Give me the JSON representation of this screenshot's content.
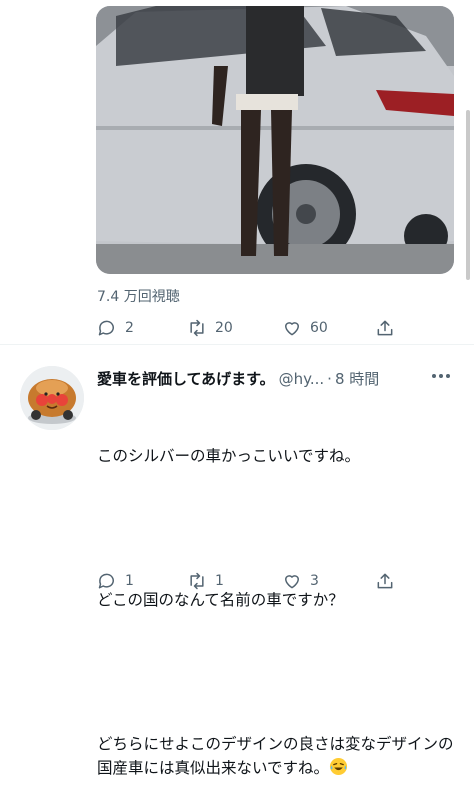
{
  "tweet": {
    "views": "7.4 万回視聴",
    "actions": {
      "reply_count": "2",
      "retweet_count": "20",
      "like_count": "60"
    }
  },
  "reply": {
    "display_name": "愛車を評価してあげます。",
    "handle": "@hy...",
    "separator": "·",
    "time": "8 時間",
    "paragraphs": [
      "このシルバーの車かっこいいですね。",
      "どこの国のなんて名前の車ですか？",
      "どちらにせよこのデザインの良さは変なデザインの国産車には真似出来ないですね。"
    ],
    "actions": {
      "reply_count": "1",
      "retweet_count": "1",
      "like_count": "3"
    }
  },
  "icons": {
    "reply": "reply-bubble-icon",
    "retweet": "retweet-arrows-icon",
    "like": "heart-icon",
    "share": "share-upload-icon",
    "more": "more-dots-icon",
    "emoji": "laughing-with-tears-emoji"
  },
  "colors": {
    "text_primary": "#0f1419",
    "text_secondary": "#536471",
    "divider": "#eff3f4"
  }
}
